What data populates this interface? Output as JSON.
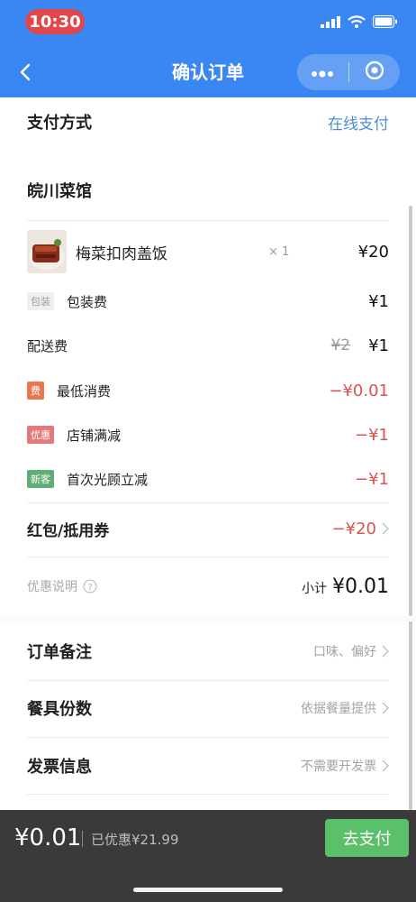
{
  "status": {
    "time": "10:30"
  },
  "nav": {
    "title": "确认订单"
  },
  "payment": {
    "label": "支付方式",
    "value": "在线支付"
  },
  "shop": {
    "name": "皖川菜馆"
  },
  "item": {
    "name": "梅菜扣肉盖饭",
    "qty": "× 1",
    "price": "¥20"
  },
  "packaging": {
    "tag": "包装",
    "label": "包装费",
    "price": "¥1"
  },
  "delivery": {
    "label": "配送费",
    "original": "¥2",
    "price": "¥1"
  },
  "min_spend": {
    "tag": "费",
    "label": "最低消费",
    "price": "−¥0.01"
  },
  "discount": {
    "tag": "优惠",
    "label": "店铺满减",
    "price": "−¥1"
  },
  "new_customer": {
    "tag": "新客",
    "label": "首次光顾立减",
    "price": "−¥1"
  },
  "coupon": {
    "label": "红包/抵用券",
    "value": "−¥20"
  },
  "summary": {
    "explain": "优惠说明",
    "subtotal_label": "小计",
    "subtotal": "¥0.01"
  },
  "remark": {
    "label": "订单备注",
    "hint": "口味、偏好"
  },
  "tableware": {
    "label": "餐具份数",
    "hint": "依据餐量提供"
  },
  "invoice": {
    "label": "发票信息",
    "hint": "不需要开发票"
  },
  "footer": {
    "total": "¥0.01",
    "saved": "已优惠¥21.99",
    "pay_button": "去支付"
  },
  "colors": {
    "nav_blue": "#3a86f2",
    "link_blue": "#4a8fd4",
    "discount_red": "#d6554d",
    "pay_green": "#5cbf6a",
    "footer_bg": "#3a3a3a"
  },
  "icons": [
    "back-icon",
    "more-icon",
    "close-target-icon",
    "signal-icon",
    "wifi-icon",
    "battery-icon",
    "help-circle-icon",
    "chevron-right-icon",
    "food-thumbnail"
  ]
}
